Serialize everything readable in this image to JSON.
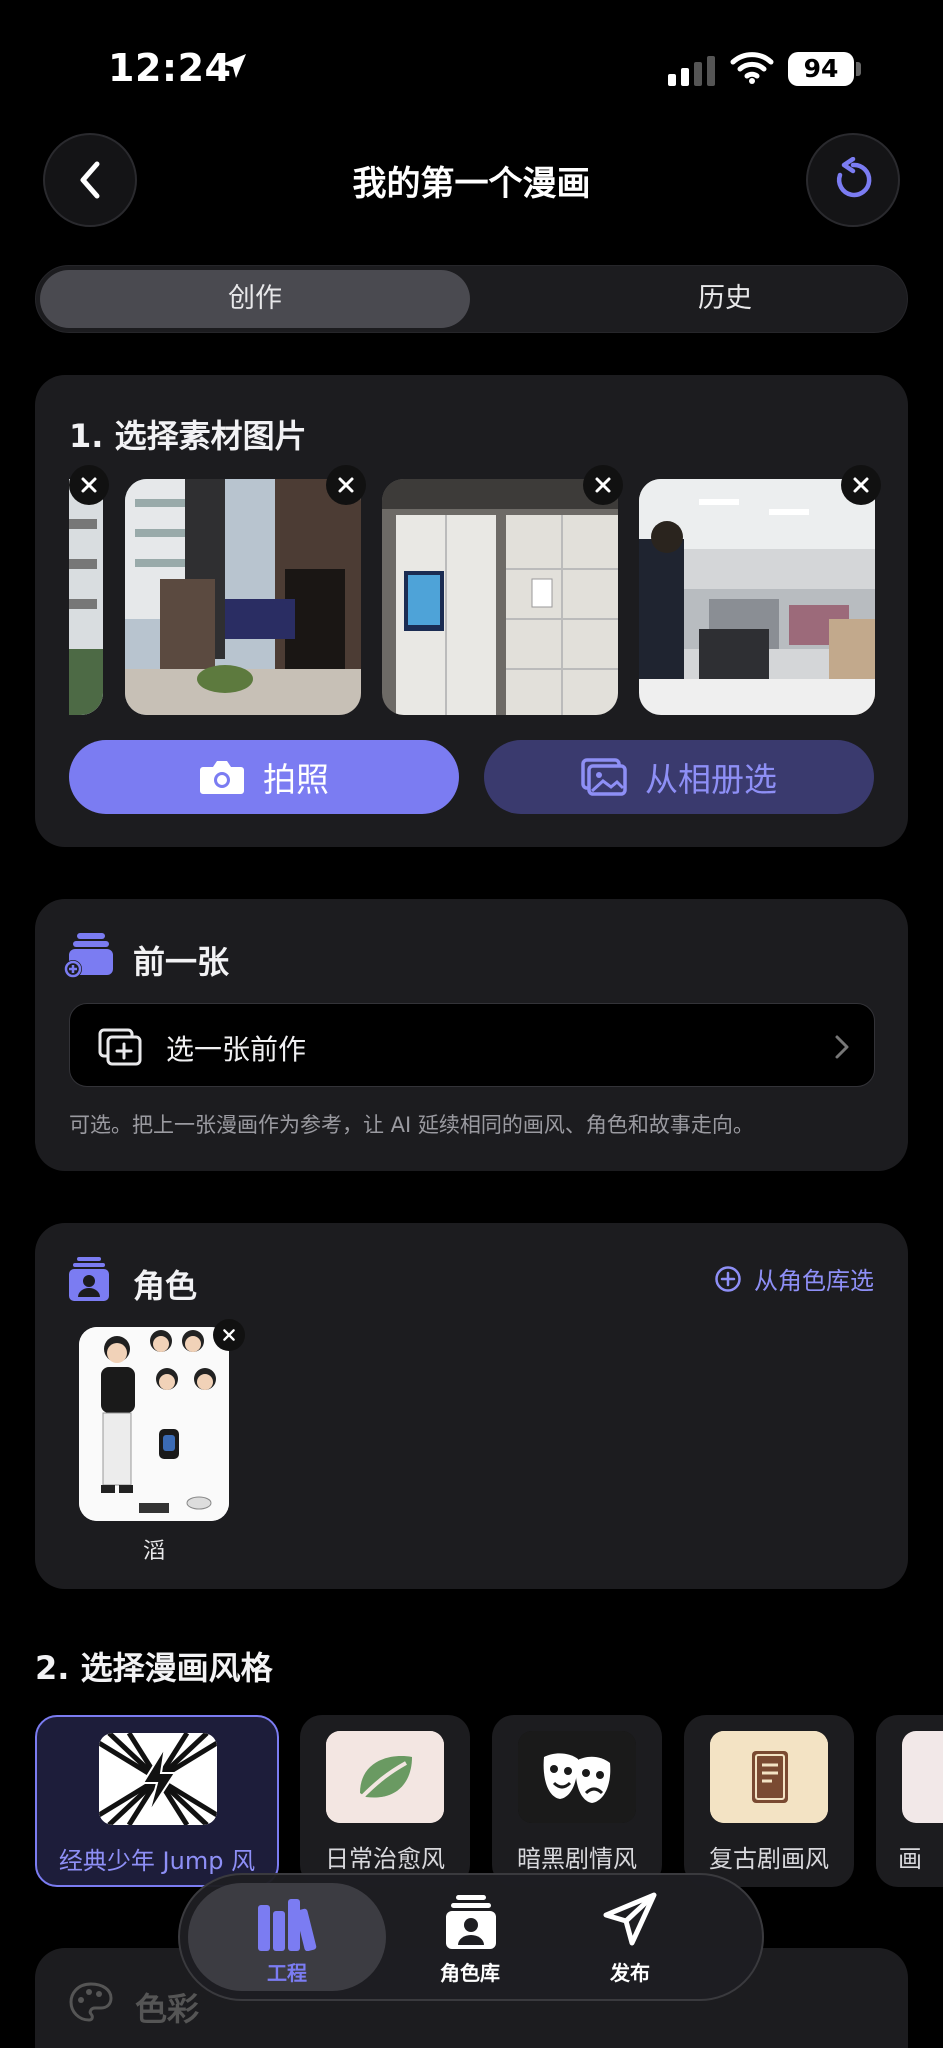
{
  "status_bar": {
    "time": "12:24",
    "battery": "94"
  },
  "header": {
    "title": "我的第一个漫画"
  },
  "segmented": {
    "tabs": [
      {
        "label": "创作"
      },
      {
        "label": "历史"
      }
    ]
  },
  "materials": {
    "heading": "1. 选择素材图片",
    "photos": [
      {
        "name": "partial-photo"
      },
      {
        "name": "hotel-entrance-photo"
      },
      {
        "name": "lockers-photo"
      },
      {
        "name": "office-photo"
      }
    ],
    "camera_label": "拍照",
    "album_label": "从相册选"
  },
  "previous": {
    "heading": "前一张",
    "select_label": "选一张前作",
    "helper": "可选。把上一张漫画作为参考，让 AI 延续相同的画风、角色和故事走向。"
  },
  "characters": {
    "heading": "角色",
    "library_link": "从角色库选",
    "items": [
      {
        "name": "滔"
      }
    ]
  },
  "styles": {
    "heading": "2. 选择漫画风格",
    "items": [
      {
        "label": "经典少年 Jump 风",
        "icon": "lightning-icon",
        "selected": true
      },
      {
        "label": "日常治愈风",
        "icon": "leaf-icon",
        "selected": false
      },
      {
        "label": "暗黑剧情风",
        "icon": "theater-masks-icon",
        "selected": false
      },
      {
        "label": "复古剧画风",
        "icon": "book-icon",
        "selected": false
      },
      {
        "label": "画",
        "icon": "unknown-icon",
        "selected": false
      }
    ]
  },
  "colors": {
    "heading": "色彩"
  },
  "tab_bar": {
    "items": [
      {
        "label": "工程",
        "icon": "books-icon",
        "active": true
      },
      {
        "label": "角色库",
        "icon": "character-library-icon",
        "active": false
      },
      {
        "label": "发布",
        "icon": "send-icon",
        "active": false
      }
    ]
  },
  "theme": {
    "accent": "#7b7cf2",
    "background": "#000000",
    "card": "#1c1c1f"
  }
}
